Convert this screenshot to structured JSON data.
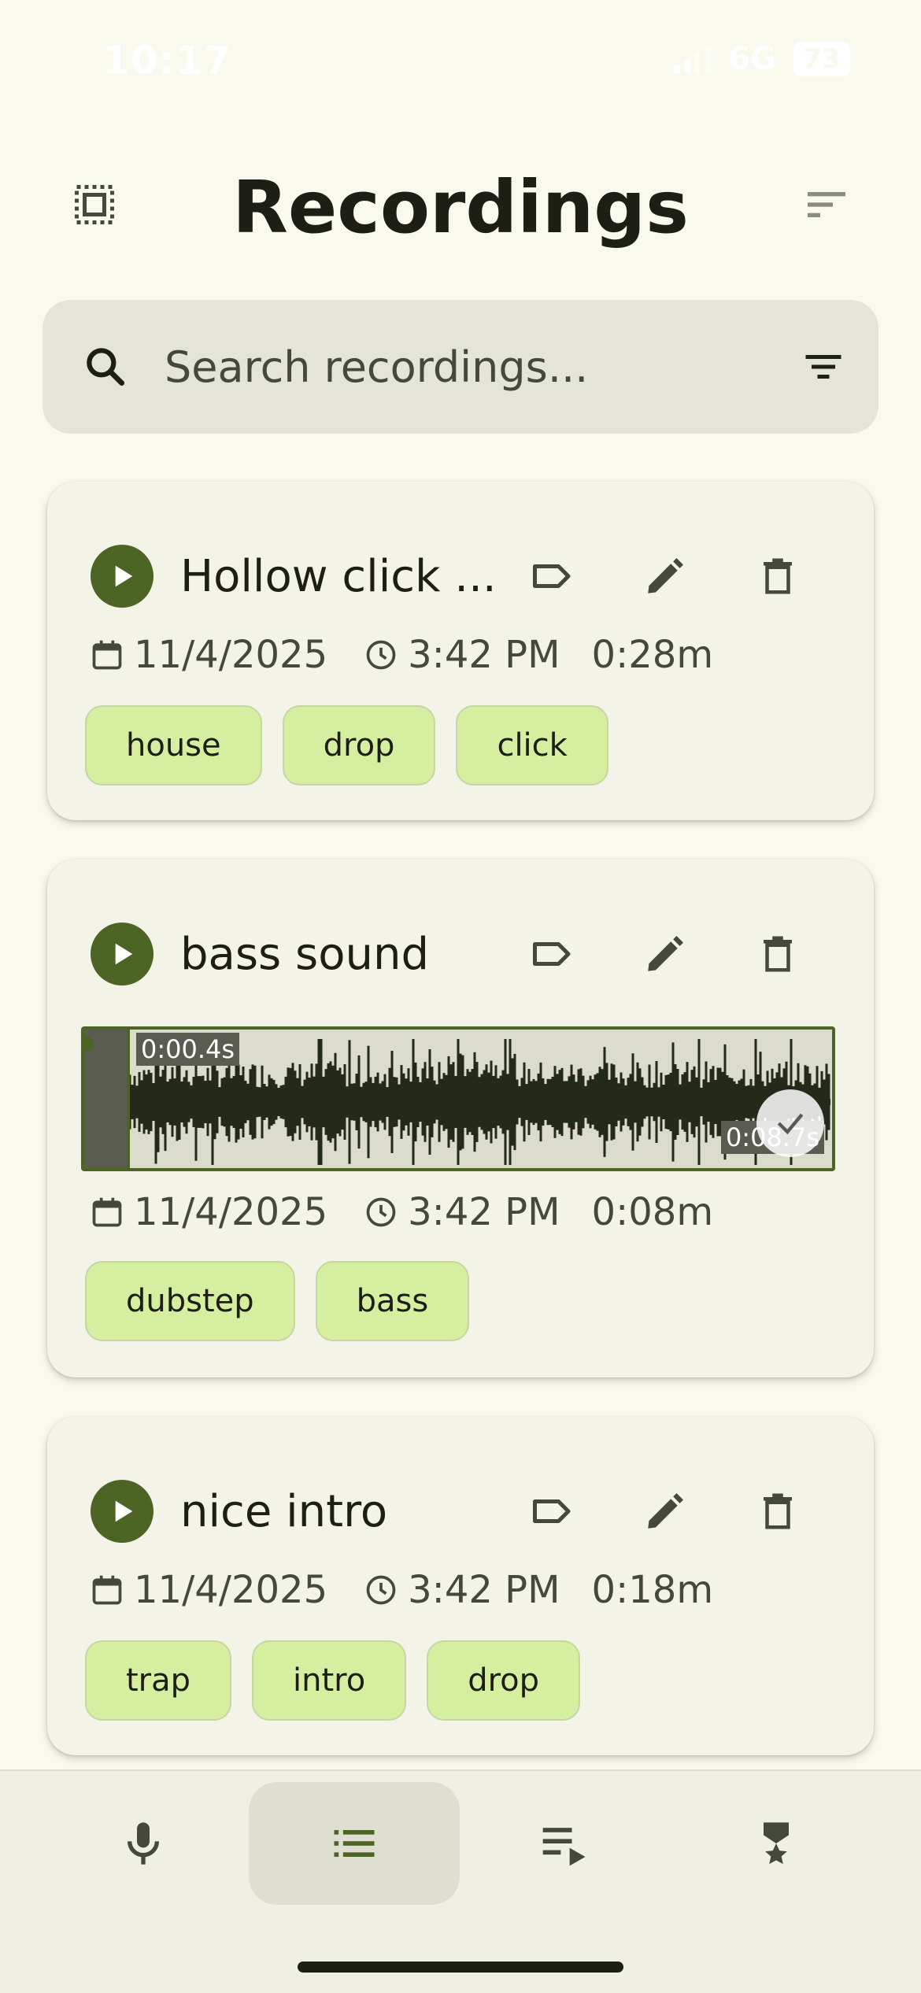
{
  "status_bar": {
    "time": "10:17",
    "network": "6G",
    "battery": "73"
  },
  "header": {
    "title": "Recordings"
  },
  "search": {
    "placeholder": "Search recordings..."
  },
  "recordings": [
    {
      "title": "Hollow click ...",
      "date": "11/4/2025",
      "time": "3:42 PM",
      "duration": "0:28m",
      "tags": [
        "house",
        "drop",
        "click"
      ]
    },
    {
      "title": "bass sound",
      "date": "11/4/2025",
      "time": "3:42 PM",
      "duration": "0:08m",
      "tags": [
        "dubstep",
        "bass"
      ],
      "waveform": {
        "start_label": "0:00.4s",
        "end_label": "0:08.7s"
      }
    },
    {
      "title": "nice intro",
      "date": "11/4/2025",
      "time": "3:42 PM",
      "duration": "0:18m",
      "tags": [
        "trap",
        "intro",
        "drop"
      ]
    }
  ],
  "bottom_nav": {
    "items": [
      "mic-icon",
      "list-icon",
      "playlist-play-icon",
      "military-medal-icon"
    ],
    "active_index": 1
  },
  "colors": {
    "background": "#f9f9ee",
    "primary": "#4c6424",
    "tag_bg": "#d6eea0",
    "card_bg": "#f3f3e8",
    "text": "#1d1f17"
  }
}
